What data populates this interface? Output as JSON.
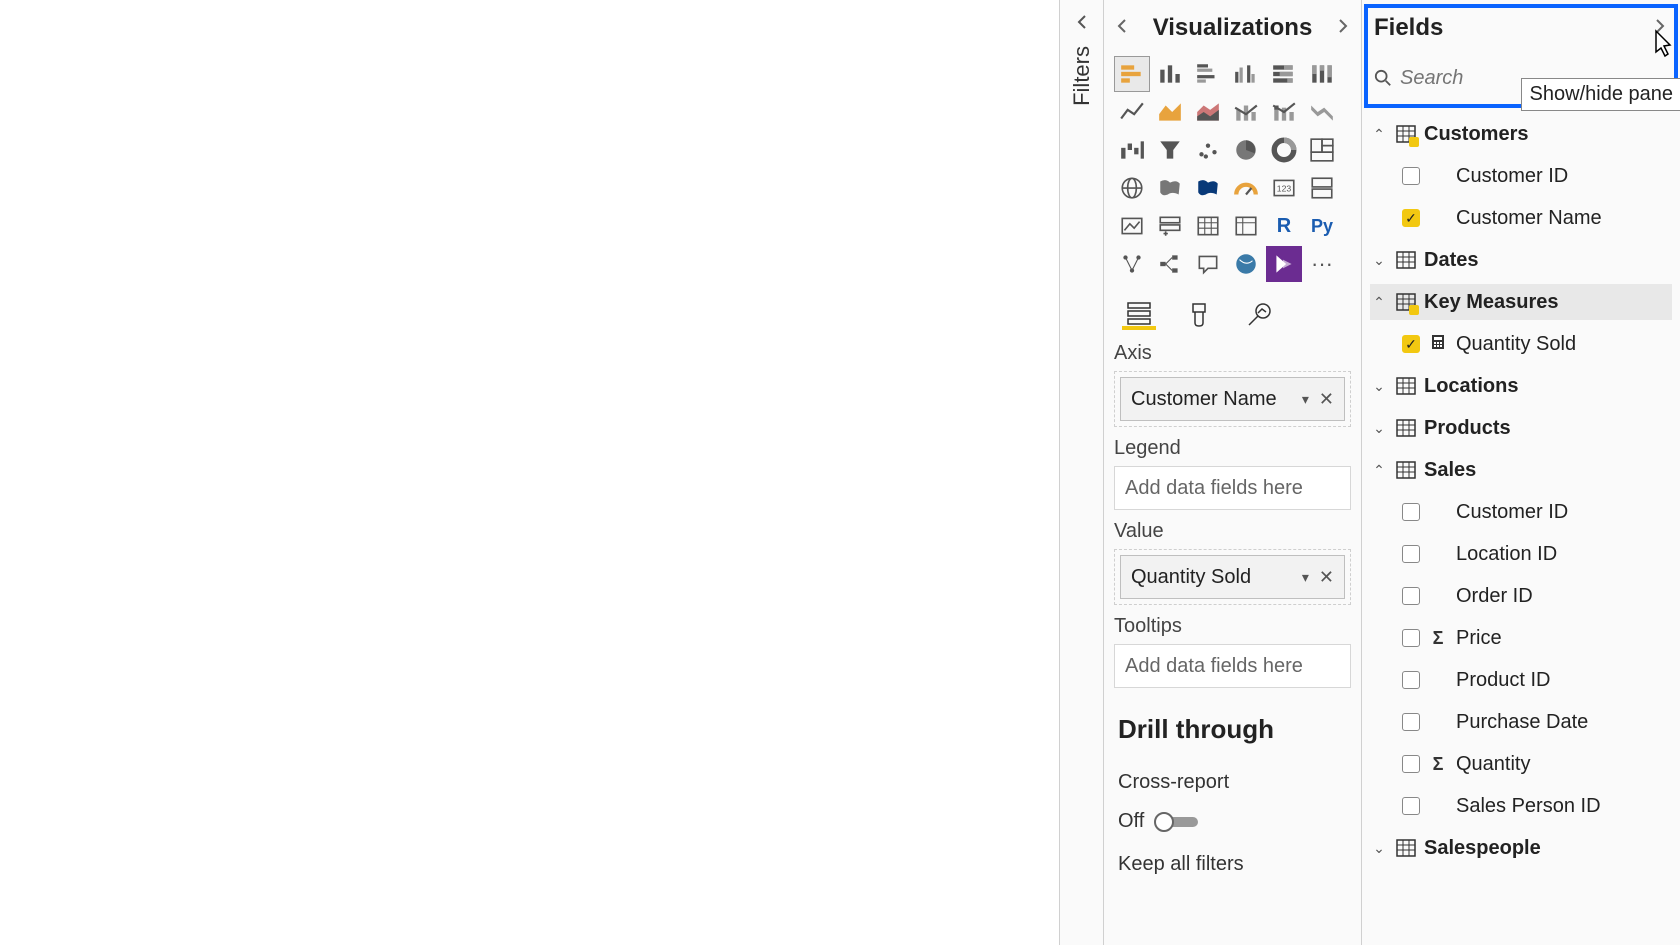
{
  "filters": {
    "label": "Filters"
  },
  "viz": {
    "title": "Visualizations",
    "r_label": "R",
    "py_label": "Py",
    "more": "···"
  },
  "wells": {
    "axis_label": "Axis",
    "axis_value": "Customer Name",
    "legend_label": "Legend",
    "legend_placeholder": "Add data fields here",
    "value_label": "Value",
    "value_value": "Quantity Sold",
    "tooltips_label": "Tooltips",
    "tooltips_placeholder": "Add data fields here",
    "drill_title": "Drill through",
    "cross_report": "Cross-report",
    "off": "Off",
    "keep_filters": "Keep all filters"
  },
  "fields": {
    "title": "Fields",
    "search_placeholder": "Search",
    "tooltip": "Show/hide pane",
    "tables": {
      "customers": {
        "name": "Customers",
        "items": [
          {
            "label": "Customer ID",
            "checked": false
          },
          {
            "label": "Customer Name",
            "checked": true
          }
        ]
      },
      "dates": {
        "name": "Dates"
      },
      "key_measures": {
        "name": "Key Measures",
        "items": [
          {
            "label": "Quantity Sold",
            "checked": true
          }
        ]
      },
      "locations": {
        "name": "Locations"
      },
      "products": {
        "name": "Products"
      },
      "sales": {
        "name": "Sales",
        "items": [
          {
            "label": "Customer ID",
            "checked": false
          },
          {
            "label": "Location ID",
            "checked": false
          },
          {
            "label": "Order ID",
            "checked": false
          },
          {
            "label": "Price",
            "checked": false,
            "sigma": true
          },
          {
            "label": "Product ID",
            "checked": false
          },
          {
            "label": "Purchase Date",
            "checked": false
          },
          {
            "label": "Quantity",
            "checked": false,
            "sigma": true
          },
          {
            "label": "Sales Person ID",
            "checked": false
          }
        ]
      },
      "salespeople": {
        "name": "Salespeople"
      }
    }
  }
}
